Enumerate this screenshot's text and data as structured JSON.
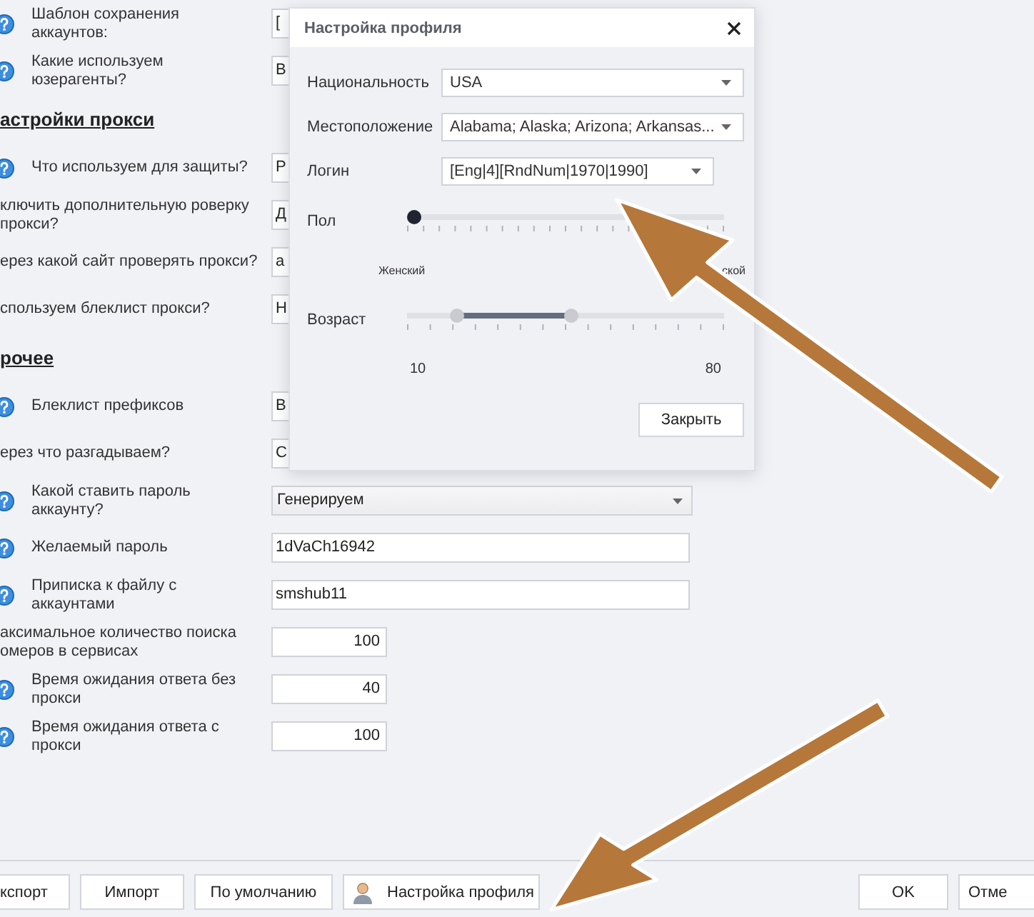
{
  "settings": [
    {
      "kind": "text-field",
      "help": true,
      "label": "Шаблон сохранения аккаунтов:",
      "value": "["
    },
    {
      "kind": "text-field",
      "help": true,
      "label": "Какие используем юзерагенты?",
      "value": "В"
    },
    {
      "kind": "heading",
      "label": "астройки прокси"
    },
    {
      "kind": "text-field",
      "help": true,
      "label": "Что используем для защиты?",
      "value": "Р"
    },
    {
      "kind": "text-field",
      "help": false,
      "label": "ключить дополнительную роверку прокси?",
      "value": "Д"
    },
    {
      "kind": "text-field",
      "help": false,
      "label": "ерез какой сайт проверять прокси?",
      "value": "a"
    },
    {
      "kind": "text-field",
      "help": false,
      "label": "спользуем блеклист прокси?",
      "value": "Н"
    },
    {
      "kind": "heading",
      "label": "рочее"
    },
    {
      "kind": "text-field",
      "help": true,
      "label": "Блеклист префиксов",
      "value": "В"
    },
    {
      "kind": "text-field",
      "help": false,
      "label": "ерез что разгадываем?",
      "value": "С"
    },
    {
      "kind": "combo",
      "help": true,
      "label": "Какой ставить пароль аккаунту?",
      "value": "Генерируем"
    },
    {
      "kind": "text-field",
      "help": true,
      "label": "Желаемый пароль",
      "value": "1dVaCh16942"
    },
    {
      "kind": "text-field",
      "help": true,
      "label": "Приписка к файлу с аккаунтами",
      "value": "smshub11"
    },
    {
      "kind": "number-field",
      "help": false,
      "label": "аксимальное количество поиска омеров в сервисах",
      "value": "100"
    },
    {
      "kind": "number-field",
      "help": true,
      "label": "Время ожидания ответа без прокси",
      "value": "40"
    },
    {
      "kind": "number-field",
      "help": true,
      "label": "Время ожидания ответа с прокси",
      "value": "100"
    }
  ],
  "dialog": {
    "title": "Настройка профиля",
    "fields": [
      {
        "label": "Национальность",
        "value": "USA",
        "wide": true
      },
      {
        "label": "Местоположение",
        "value": "Alabama; Alaska; Arizona; Arkansas...",
        "wide": true
      },
      {
        "label": "Логин",
        "value": "[Eng|4][RndNum|1970|1990]",
        "wide": false
      }
    ],
    "gender": {
      "label": "Пол",
      "level": 0,
      "min_label": "Женский",
      "max_label": "ской"
    },
    "age": {
      "label": "Возраст",
      "thumbs": [
        {
          "level": 0.14
        },
        {
          "level": 0.52
        }
      ],
      "min_label": "10",
      "max_label": "80"
    },
    "button": "Закрыть"
  },
  "footer": {
    "left_buttons": [
      {
        "label": "кспорт",
        "icon": false
      },
      {
        "label": "Импорт",
        "icon": false
      },
      {
        "label": "По умолчанию",
        "icon": false
      },
      {
        "label": "Настройка профиля",
        "icon": true
      }
    ],
    "right_buttons": [
      {
        "label": "OK"
      },
      {
        "label": "Отме"
      }
    ]
  }
}
